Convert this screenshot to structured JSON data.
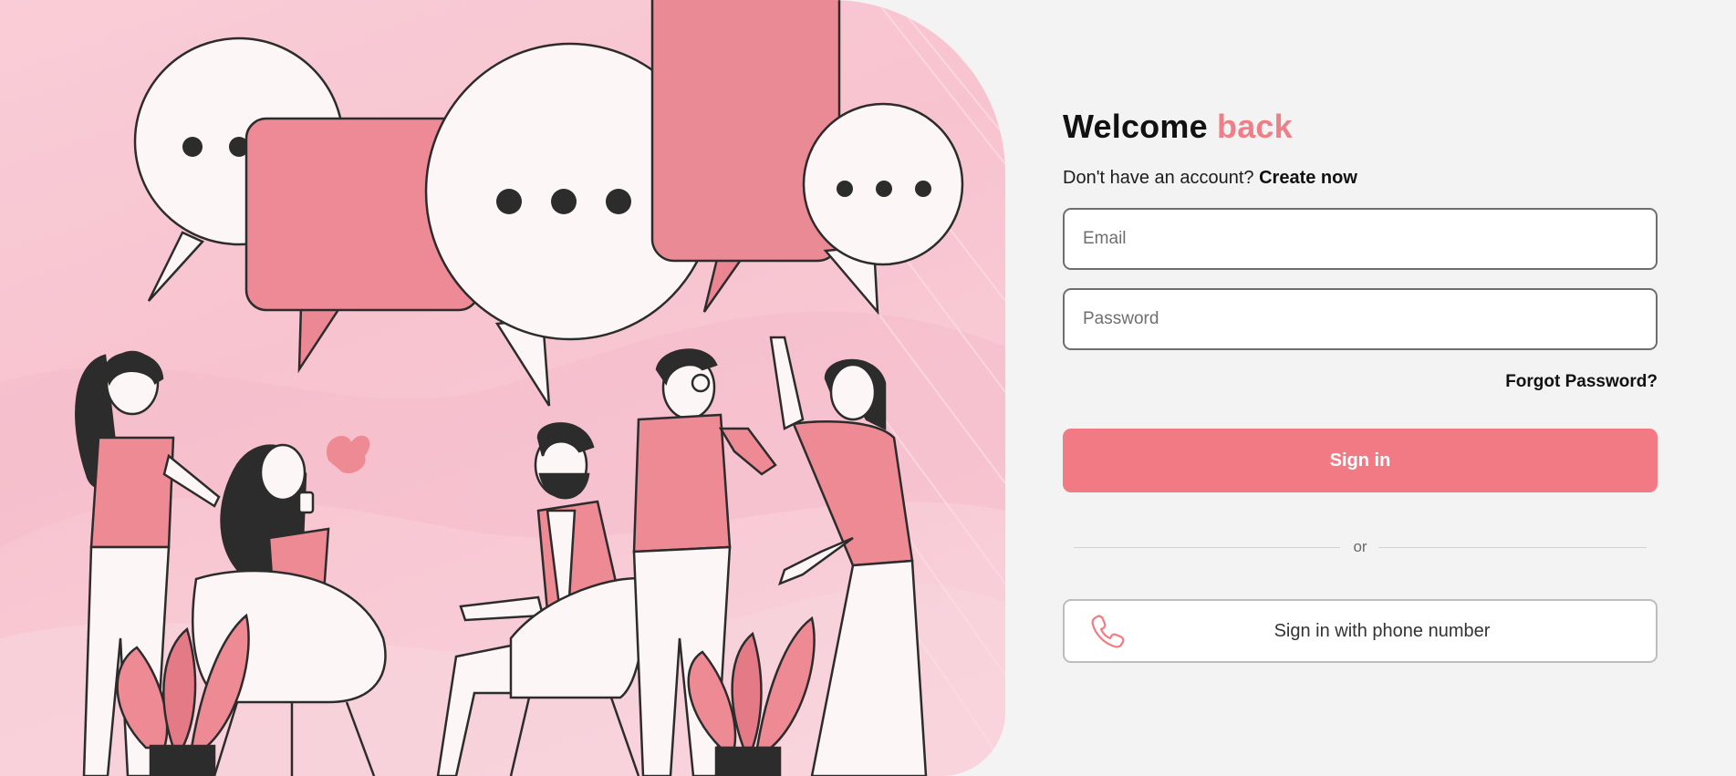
{
  "hero": {
    "illustration": "people-chatting-illustration",
    "background_color": "#f8c9d3",
    "accent_color": "#ee8a93"
  },
  "form": {
    "title_main": "Welcome",
    "title_accent": "back",
    "signup_prompt": "Don't have an account?",
    "signup_link": "Create now",
    "email_placeholder": "Email",
    "password_placeholder": "Password",
    "forgot_password": "Forgot Password?",
    "signin_label": "Sign in",
    "divider_text": "or",
    "phone_signin_label": "Sign in with phone number",
    "phone_icon": "phone-icon"
  },
  "colors": {
    "accent": "#f27a84",
    "title_accent": "#ee7f89",
    "background": "#f3f3f3",
    "input_border": "#6e6e6e"
  }
}
